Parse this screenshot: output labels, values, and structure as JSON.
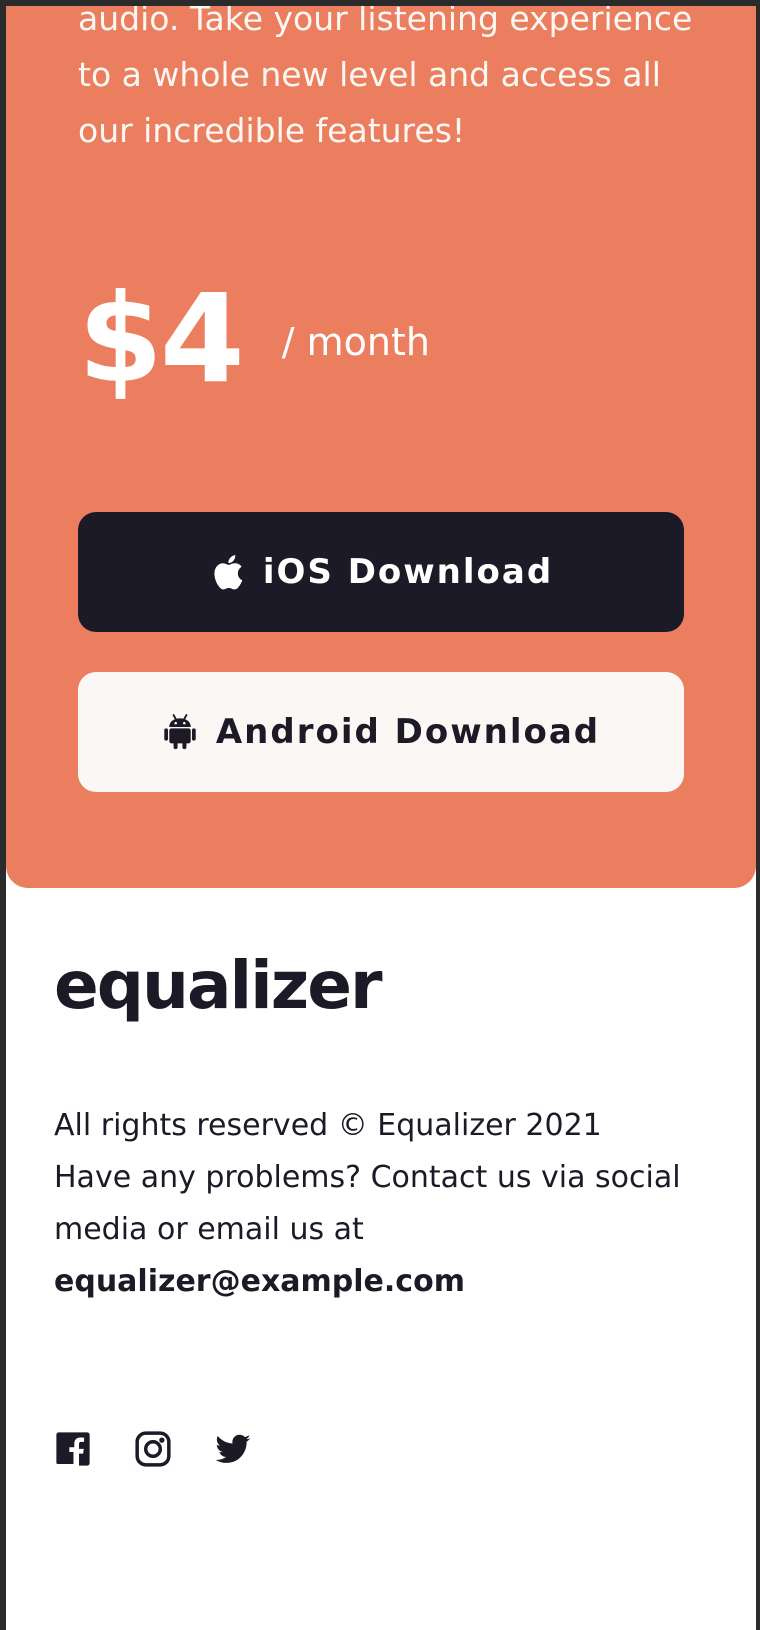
{
  "promo": {
    "description": "audio. Take your listening experience to a whole new level and access all our incredible features!",
    "price": {
      "amount": "$4",
      "period": "/ month"
    },
    "buttons": {
      "ios_label": "iOS Download",
      "android_label": "Android Download"
    }
  },
  "footer": {
    "logo": "equalizer",
    "rights": "All rights reserved © Equalizer 2021",
    "contact": "Have any problems? Contact us via social media or email us at",
    "email": "equalizer@example.com",
    "social_icons": [
      "facebook-icon",
      "instagram-icon",
      "twitter-icon"
    ]
  },
  "colors": {
    "accent": "#eb7e5f",
    "dark": "#1b1a26",
    "light": "#faf7f5"
  }
}
